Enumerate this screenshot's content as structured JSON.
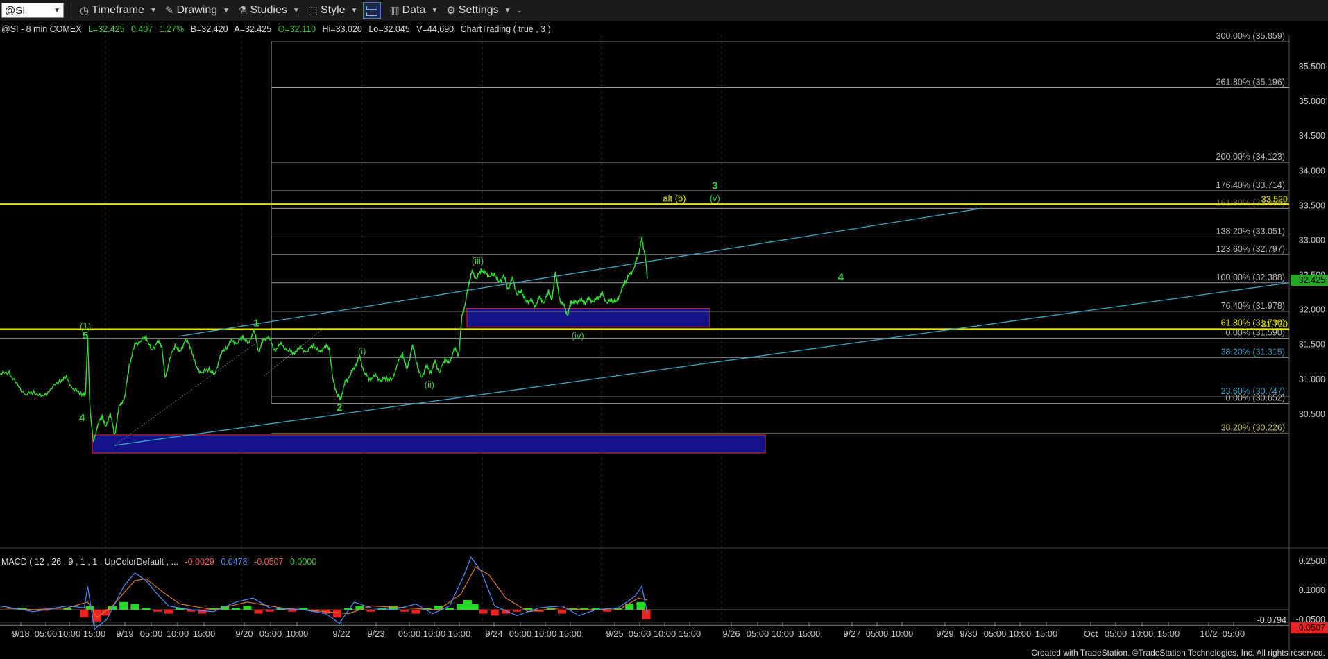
{
  "toolbar": {
    "symbol": "@SI",
    "buttons": [
      {
        "label": "Timeframe",
        "icon": "clock-icon"
      },
      {
        "label": "Drawing",
        "icon": "pencil-icon"
      },
      {
        "label": "Studies",
        "icon": "flask-icon"
      },
      {
        "label": "Style",
        "icon": "style-icon"
      },
      {
        "label": "Data",
        "icon": "bar-chart-icon"
      },
      {
        "label": "Settings",
        "icon": "gear-icon"
      }
    ]
  },
  "header": {
    "symbol_info": "@SI - 8 min  COMEX",
    "last": "L=32.425",
    "change": "0.407",
    "pct": "1.27%",
    "bid": "B=32.420",
    "ask": "A=32.425",
    "open": "O=32.110",
    "high": "Hi=33.020",
    "low": "Lo=32.045",
    "volume": "V=44,690",
    "study": "ChartTrading ( true , 3 )"
  },
  "macd_header": {
    "label": "MACD ( 12 , 26 , 9 , 1 , 1 , UpColorDefault , ...",
    "v1": "-0.0029",
    "v2": "0.0478",
    "v3": "-0.0507",
    "v4": "0.0000"
  },
  "footer": "Created with TradeStation. ©TradeStation Technologies, Inc. All rights reserved.",
  "chart_data": {
    "type": "line",
    "ylim": [
      29.95,
      35.95
    ],
    "y_ticks": [
      "35.500",
      "35.000",
      "34.500",
      "34.000",
      "33.500",
      "33.000",
      "32.500",
      "32.000",
      "31.500",
      "31.000",
      "30.500"
    ],
    "x_tick_labels": [
      "9/18",
      "05:00",
      "10:00",
      "15:00",
      "9/19",
      "05:00",
      "10:00",
      "15:00",
      "9/20",
      "05:00",
      "10:00",
      "9/22",
      "9/23",
      "05:00",
      "10:00",
      "15:00",
      "9/24",
      "05:00",
      "10:00",
      "15:00",
      "9/25",
      "05:00",
      "10:00",
      "15:00",
      "9/26",
      "05:00",
      "10:00",
      "15:00",
      "9/27",
      "05:00",
      "10:00",
      "9/29",
      "9/30",
      "05:00",
      "10:00",
      "15:00",
      "Oct",
      "05:00",
      "10:00",
      "15:00",
      "10/2",
      "05:00"
    ],
    "last_price": "32.425",
    "price_path": [
      [
        0.0,
        31.08
      ],
      [
        0.8,
        31.1
      ],
      [
        1.5,
        30.92
      ],
      [
        2.3,
        30.78
      ],
      [
        3.0,
        30.82
      ],
      [
        3.8,
        30.74
      ],
      [
        4.5,
        30.86
      ],
      [
        5.3,
        30.98
      ],
      [
        5.9,
        31.02
      ],
      [
        6.5,
        30.86
      ],
      [
        7.2,
        30.8
      ],
      [
        7.6,
        30.76
      ],
      [
        7.8,
        31.6
      ],
      [
        8.0,
        30.6
      ],
      [
        8.3,
        30.08
      ],
      [
        8.7,
        30.35
      ],
      [
        9.1,
        30.48
      ],
      [
        9.4,
        30.3
      ],
      [
        9.8,
        30.52
      ],
      [
        10.2,
        30.2
      ],
      [
        10.6,
        30.6
      ],
      [
        11.1,
        30.75
      ],
      [
        11.5,
        31.2
      ],
      [
        12.0,
        31.5
      ],
      [
        12.5,
        31.55
      ],
      [
        13.0,
        31.62
      ],
      [
        13.5,
        31.4
      ],
      [
        14.0,
        31.55
      ],
      [
        14.4,
        31.48
      ],
      [
        14.7,
        31.0
      ],
      [
        15.1,
        31.3
      ],
      [
        15.6,
        31.5
      ],
      [
        16.0,
        31.38
      ],
      [
        16.5,
        31.58
      ],
      [
        17.0,
        31.45
      ],
      [
        17.5,
        31.15
      ],
      [
        18.0,
        31.1
      ],
      [
        18.6,
        31.15
      ],
      [
        19.1,
        31.05
      ],
      [
        19.6,
        31.35
      ],
      [
        20.1,
        31.45
      ],
      [
        20.6,
        31.55
      ],
      [
        21.1,
        31.52
      ],
      [
        21.6,
        31.62
      ],
      [
        22.1,
        31.5
      ],
      [
        22.6,
        31.72
      ],
      [
        23.0,
        31.4
      ],
      [
        23.4,
        31.55
      ],
      [
        23.9,
        31.62
      ],
      [
        24.4,
        31.42
      ],
      [
        25.0,
        31.5
      ],
      [
        25.6,
        31.42
      ],
      [
        26.1,
        31.38
      ],
      [
        26.7,
        31.45
      ],
      [
        27.3,
        31.4
      ],
      [
        27.9,
        31.5
      ],
      [
        28.4,
        31.38
      ],
      [
        28.9,
        31.48
      ],
      [
        29.3,
        31.45
      ],
      [
        29.6,
        31.0
      ],
      [
        30.0,
        30.78
      ],
      [
        30.3,
        30.72
      ],
      [
        30.7,
        30.95
      ],
      [
        31.1,
        31.05
      ],
      [
        31.6,
        31.2
      ],
      [
        32.0,
        31.32
      ],
      [
        32.4,
        31.1
      ],
      [
        32.9,
        31.0
      ],
      [
        33.4,
        31.05
      ],
      [
        33.9,
        30.98
      ],
      [
        34.4,
        31.02
      ],
      [
        34.9,
        30.98
      ],
      [
        35.3,
        31.2
      ],
      [
        35.8,
        31.38
      ],
      [
        36.2,
        31.12
      ],
      [
        36.7,
        31.5
      ],
      [
        37.1,
        31.22
      ],
      [
        37.5,
        31.0
      ],
      [
        37.9,
        31.2
      ],
      [
        38.3,
        31.1
      ],
      [
        38.7,
        31.25
      ],
      [
        39.1,
        31.1
      ],
      [
        39.6,
        31.3
      ],
      [
        40.0,
        31.22
      ],
      [
        40.4,
        31.45
      ],
      [
        40.8,
        31.35
      ],
      [
        41.1,
        31.9
      ],
      [
        41.4,
        32.1
      ],
      [
        41.7,
        32.38
      ],
      [
        42.0,
        32.55
      ],
      [
        42.4,
        32.45
      ],
      [
        42.8,
        32.58
      ],
      [
        43.2,
        32.52
      ],
      [
        43.6,
        32.48
      ],
      [
        44.0,
        32.52
      ],
      [
        44.4,
        32.38
      ],
      [
        44.8,
        32.5
      ],
      [
        45.2,
        32.3
      ],
      [
        45.6,
        32.45
      ],
      [
        46.0,
        32.22
      ],
      [
        46.4,
        32.28
      ],
      [
        46.8,
        32.1
      ],
      [
        47.2,
        32.15
      ],
      [
        47.6,
        32.05
      ],
      [
        48.0,
        32.18
      ],
      [
        48.4,
        32.1
      ],
      [
        48.8,
        32.28
      ],
      [
        49.1,
        32.12
      ],
      [
        49.4,
        32.55
      ],
      [
        49.8,
        32.15
      ],
      [
        50.2,
        32.05
      ],
      [
        50.5,
        31.92
      ],
      [
        50.8,
        32.12
      ],
      [
        51.2,
        32.1
      ],
      [
        51.6,
        32.15
      ],
      [
        52.0,
        32.1
      ],
      [
        52.4,
        32.15
      ],
      [
        52.8,
        32.12
      ],
      [
        53.2,
        32.18
      ],
      [
        53.6,
        32.22
      ],
      [
        54.0,
        32.1
      ],
      [
        54.4,
        32.15
      ],
      [
        54.8,
        32.1
      ],
      [
        55.2,
        32.25
      ],
      [
        55.6,
        32.4
      ],
      [
        56.0,
        32.5
      ],
      [
        56.4,
        32.6
      ],
      [
        56.8,
        32.8
      ],
      [
        57.1,
        33.02
      ],
      [
        57.4,
        32.78
      ],
      [
        57.6,
        32.45
      ]
    ],
    "fib_levels": [
      {
        "label": "300.00% (35.859)",
        "value": 35.859
      },
      {
        "label": "261.80% (35.196)",
        "value": 35.196
      },
      {
        "label": "200.00% (34.123)",
        "value": 34.123
      },
      {
        "label": "176.40% (33.714)",
        "value": 33.714
      },
      {
        "label": "161.80% (33.460)",
        "value": 33.46
      },
      {
        "label": "138.20% (33.051)",
        "value": 33.051
      },
      {
        "label": "123.60% (32.797)",
        "value": 32.797
      },
      {
        "label": "100.00% (32.388)",
        "value": 32.388
      },
      {
        "label": "76.40% (31.978)",
        "value": 31.978
      },
      {
        "label": "61.80% (31.730)",
        "value": 31.73
      },
      {
        "label": "0.00% (31.590)",
        "value": 31.59
      },
      {
        "label": "38.20% (31.315)",
        "value": 31.315
      },
      {
        "label": "23.60% (30.747)",
        "value": 30.747
      },
      {
        "label": "0.00% (30.652)",
        "value": 30.652
      },
      {
        "label": "38.20% (30.226)",
        "value": 30.226
      }
    ],
    "yellow_lines": [
      {
        "value": 33.52,
        "label": "33.520"
      },
      {
        "value": 31.72,
        "label": "31.730"
      }
    ],
    "wave_labels": [
      {
        "text": "(1)",
        "t": 7.6,
        "y": 31.72,
        "color": "#33cc33"
      },
      {
        "text": "5",
        "t": 7.6,
        "y": 31.58,
        "color": "#33cc33"
      },
      {
        "text": "4",
        "t": 7.3,
        "y": 30.4,
        "color": "#33cc33"
      },
      {
        "text": "1",
        "t": 22.8,
        "y": 31.76,
        "color": "#33cc33"
      },
      {
        "text": "2",
        "t": 30.2,
        "y": 30.55,
        "color": "#33cc33"
      },
      {
        "text": "(i)",
        "t": 32.2,
        "y": 31.36,
        "color": "#33cc33"
      },
      {
        "text": "(ii)",
        "t": 38.2,
        "y": 30.88,
        "color": "#33cc33"
      },
      {
        "text": "(iii)",
        "t": 42.5,
        "y": 32.66,
        "color": "#33cc33"
      },
      {
        "text": "(iv)",
        "t": 51.4,
        "y": 31.58,
        "color": "#33cc33"
      },
      {
        "text": "alt (b)",
        "t": 60.0,
        "y": 33.56,
        "color": "#e6e600"
      },
      {
        "text": "3",
        "t": 63.6,
        "y": 33.74,
        "color": "#33cc33"
      },
      {
        "text": "(v)",
        "t": 63.6,
        "y": 33.56,
        "color": "#33cc33"
      },
      {
        "text": "4",
        "t": 74.8,
        "y": 32.42,
        "color": "#33cc33"
      }
    ],
    "macd": {
      "y_ticks": [
        "0.2500",
        "0.1000",
        "-0.0500"
      ],
      "readouts": [
        "-0.0794",
        "-0.0507"
      ],
      "hist": [
        [
          2,
          0.01
        ],
        [
          4,
          -0.005
        ],
        [
          6,
          0.008
        ],
        [
          7.5,
          -0.04
        ],
        [
          8.0,
          0.02
        ],
        [
          8.6,
          -0.06
        ],
        [
          9.4,
          -0.03
        ],
        [
          10,
          0.02
        ],
        [
          11,
          0.04
        ],
        [
          12,
          0.03
        ],
        [
          13,
          0.01
        ],
        [
          14,
          -0.01
        ],
        [
          15,
          -0.02
        ],
        [
          16,
          0.01
        ],
        [
          17,
          -0.01
        ],
        [
          18,
          -0.02
        ],
        [
          19,
          0.01
        ],
        [
          20,
          0.02
        ],
        [
          21,
          0.01
        ],
        [
          22,
          0.02
        ],
        [
          23,
          -0.02
        ],
        [
          24,
          -0.01
        ],
        [
          25,
          0.01
        ],
        [
          26,
          -0.01
        ],
        [
          27,
          0.01
        ],
        [
          28,
          -0.01
        ],
        [
          29,
          -0.02
        ],
        [
          30,
          -0.04
        ],
        [
          31,
          0.01
        ],
        [
          32,
          0.02
        ],
        [
          33,
          -0.01
        ],
        [
          34,
          0.01
        ],
        [
          35,
          0.02
        ],
        [
          36,
          -0.01
        ],
        [
          37,
          -0.02
        ],
        [
          38,
          0.01
        ],
        [
          39,
          0.02
        ],
        [
          40,
          0.01
        ],
        [
          41,
          0.03
        ],
        [
          41.6,
          0.05
        ],
        [
          42.2,
          0.03
        ],
        [
          43,
          -0.02
        ],
        [
          44,
          -0.03
        ],
        [
          45,
          -0.02
        ],
        [
          46,
          -0.01
        ],
        [
          47,
          0.01
        ],
        [
          48,
          -0.01
        ],
        [
          49,
          0.01
        ],
        [
          50,
          -0.02
        ],
        [
          51,
          0.01
        ],
        [
          52,
          0.01
        ],
        [
          53,
          0.01
        ],
        [
          54,
          -0.01
        ],
        [
          55,
          0.01
        ],
        [
          56,
          0.03
        ],
        [
          57,
          0.04
        ],
        [
          57.5,
          -0.05
        ]
      ],
      "macd_line": [
        [
          0,
          0.02
        ],
        [
          3,
          -0.01
        ],
        [
          6,
          0.02
        ],
        [
          7.5,
          0.01
        ],
        [
          7.8,
          0.12
        ],
        [
          8.4,
          -0.1
        ],
        [
          9.5,
          -0.05
        ],
        [
          11,
          0.12
        ],
        [
          12,
          0.19
        ],
        [
          13,
          0.15
        ],
        [
          14,
          0.08
        ],
        [
          15,
          0.02
        ],
        [
          17,
          0.0
        ],
        [
          19,
          -0.01
        ],
        [
          21,
          0.04
        ],
        [
          22.5,
          0.06
        ],
        [
          24,
          0.01
        ],
        [
          27,
          0.0
        ],
        [
          29,
          -0.02
        ],
        [
          30.2,
          -0.07
        ],
        [
          31.5,
          0.04
        ],
        [
          33,
          0.01
        ],
        [
          35,
          0.0
        ],
        [
          37,
          0.03
        ],
        [
          38.5,
          -0.02
        ],
        [
          40,
          0.02
        ],
        [
          41.3,
          0.18
        ],
        [
          41.9,
          0.27
        ],
        [
          42.8,
          0.2
        ],
        [
          44,
          0.02
        ],
        [
          46,
          -0.03
        ],
        [
          48,
          0.01
        ],
        [
          50,
          0.02
        ],
        [
          51.5,
          -0.03
        ],
        [
          53,
          0.0
        ],
        [
          55,
          0.01
        ],
        [
          56.5,
          0.07
        ],
        [
          57.1,
          0.12
        ],
        [
          57.6,
          -0.02
        ]
      ],
      "signal_line": [
        [
          0,
          0.01
        ],
        [
          3,
          0.0
        ],
        [
          6,
          0.01
        ],
        [
          7.8,
          0.04
        ],
        [
          8.6,
          -0.04
        ],
        [
          10,
          0.02
        ],
        [
          12,
          0.15
        ],
        [
          13,
          0.16
        ],
        [
          14.5,
          0.09
        ],
        [
          16,
          0.03
        ],
        [
          19,
          0.0
        ],
        [
          22,
          0.04
        ],
        [
          25,
          0.01
        ],
        [
          29,
          -0.01
        ],
        [
          31,
          -0.02
        ],
        [
          33,
          0.02
        ],
        [
          36,
          0.01
        ],
        [
          39,
          0.0
        ],
        [
          41,
          0.08
        ],
        [
          42.3,
          0.22
        ],
        [
          43.5,
          0.18
        ],
        [
          45,
          0.06
        ],
        [
          47,
          -0.01
        ],
        [
          50,
          0.01
        ],
        [
          52,
          0.0
        ],
        [
          55,
          0.0
        ],
        [
          56.8,
          0.06
        ],
        [
          57.6,
          0.05
        ]
      ]
    }
  }
}
